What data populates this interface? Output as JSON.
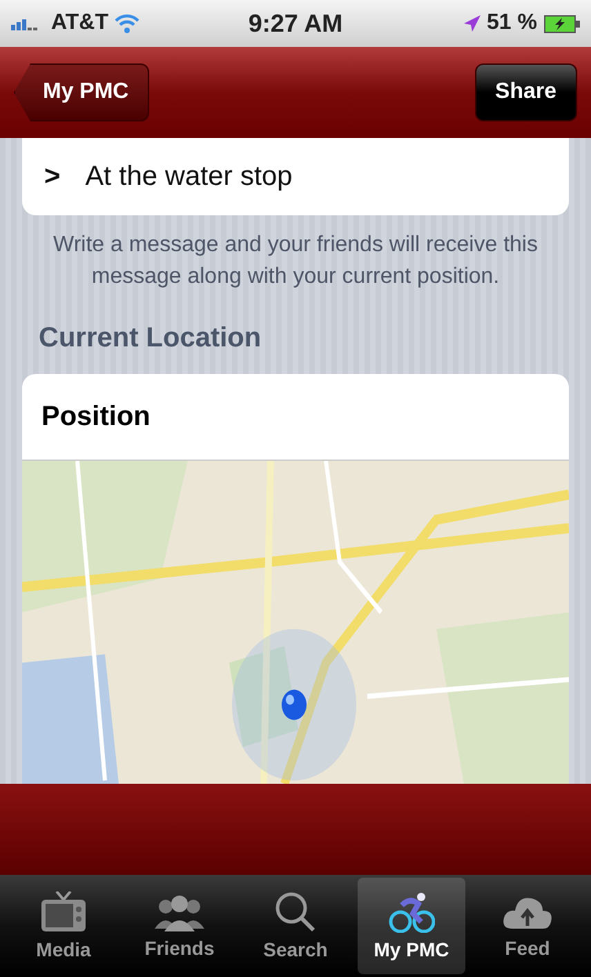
{
  "status_bar": {
    "carrier": "AT&T",
    "time": "9:27 AM",
    "battery": "51 %"
  },
  "nav_bar": {
    "back": "My PMC",
    "action": "Share"
  },
  "message_row": {
    "chevron": ">",
    "text": "At the water stop"
  },
  "hint": "Write a message and your friends will receive this message along with your current position.",
  "section_title": "Current Location",
  "position_card": {
    "title": "Position"
  },
  "tab_bar": [
    {
      "label": "Media",
      "selected": false
    },
    {
      "label": "Friends",
      "selected": false
    },
    {
      "label": "Search",
      "selected": false
    },
    {
      "label": "My PMC",
      "selected": true
    },
    {
      "label": "Feed",
      "selected": false
    }
  ]
}
